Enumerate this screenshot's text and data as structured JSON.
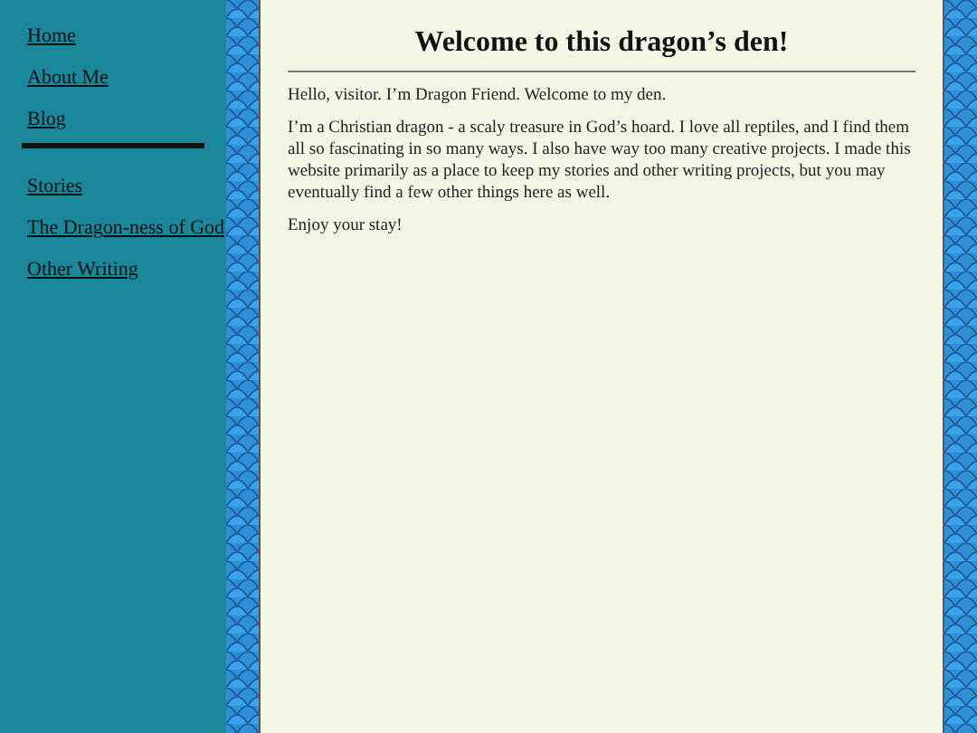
{
  "sidebar": {
    "groups": [
      {
        "links": [
          "Home",
          "About Me",
          "Blog"
        ]
      },
      {
        "links": [
          "Stories",
          "The Dragon-ness of God",
          "Other Writing"
        ]
      }
    ]
  },
  "main": {
    "heading": "Welcome to this dragon’s den!",
    "paragraphs": [
      "Hello, visitor. I’m Dragon Friend. Welcome to my den.",
      "I’m a Christian dragon - a scaly treasure in God’s hoard. I love all reptiles, and I find them all so fascinating in so many ways. I also have way too many creative projects. I made this website primarily as a place to keep my stories and other writing projects, but you may eventually find a few other things here as well.",
      "Enjoy your stay!"
    ]
  }
}
